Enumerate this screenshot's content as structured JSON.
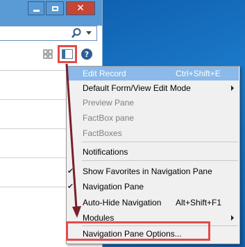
{
  "window": {
    "minimize_icon": "minimize-icon",
    "maximize_icon": "maximize-icon",
    "close_icon": "close-icon",
    "close_glyph": "✕"
  },
  "toolbar": {
    "search_icon": "search-icon",
    "help_glyph": "?"
  },
  "menu": {
    "items": [
      {
        "label": "Edit Record",
        "shortcut": "Ctrl+Shift+E",
        "state": "disabled-highlighted"
      },
      {
        "label": "Default Form/View Edit Mode",
        "submenu": true
      },
      {
        "label": "Preview Pane",
        "state": "disabled"
      },
      {
        "label": "FactBox pane",
        "state": "disabled"
      },
      {
        "label": "FactBoxes",
        "state": "disabled"
      },
      {
        "label": "Notifications"
      },
      {
        "label": "Show Favorites in Navigation Pane",
        "checked": true
      },
      {
        "label": "Navigation Pane",
        "checked": true
      },
      {
        "label": "Auto-Hide Navigation",
        "shortcut": "Alt+Shift+F1"
      },
      {
        "label": "Modules",
        "submenu": true
      },
      {
        "label": "Navigation Pane Options..."
      }
    ],
    "check_glyph": "✔"
  },
  "colors": {
    "highlight_box": "#e54a4a",
    "arrow": "#7a1f2a",
    "menu_highlight": "#8ab9ea"
  }
}
